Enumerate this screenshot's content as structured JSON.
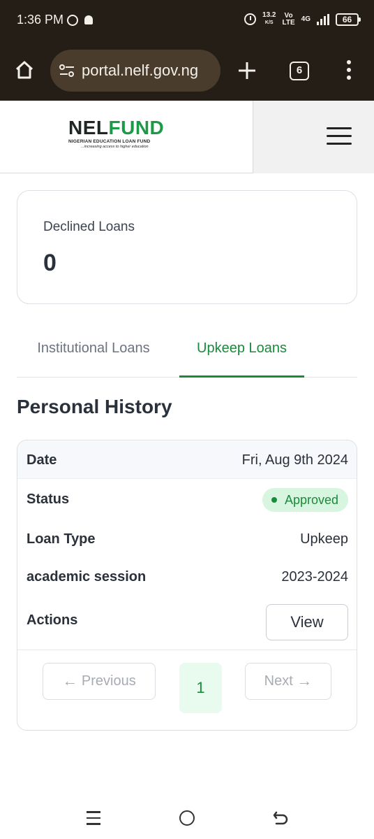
{
  "status_bar": {
    "time": "1:36 PM",
    "net_speed_value": "13.2",
    "net_speed_unit": "K/S",
    "volte_top": "Vo",
    "volte_bottom": "LTE",
    "network": "4G",
    "battery": "66",
    "icons": [
      "whatsapp-icon",
      "android-icon",
      "alarm-icon",
      "signal-icon",
      "battery-icon"
    ]
  },
  "browser": {
    "url": "portal.nelf.gov.ng",
    "tab_count": "6",
    "icons": [
      "home-icon",
      "tune-icon",
      "plus-icon",
      "tabs-icon",
      "menu-dots-icon"
    ]
  },
  "header": {
    "logo_part1": "NEL",
    "logo_part2": "FUND",
    "logo_subtitle": "NIGERIAN EDUCATION LOAN FUND",
    "logo_tagline": "...increasing access to higher education",
    "brand_color": "#1c9a48"
  },
  "declined": {
    "label": "Declined Loans",
    "value": "0"
  },
  "tabs": [
    {
      "label": "Institutional Loans",
      "active": false
    },
    {
      "label": "Upkeep Loans",
      "active": true
    }
  ],
  "section_title": "Personal History",
  "history": {
    "date_label": "Date",
    "date_value": "Fri, Aug 9th 2024",
    "status_label": "Status",
    "status_value": "Approved",
    "status_color": "#1a8a3b",
    "loan_type_label": "Loan Type",
    "loan_type_value": "Upkeep",
    "session_label": "academic session",
    "session_value": "2023-2024",
    "actions_label": "Actions",
    "view_label": "View"
  },
  "pagination": {
    "previous_label": "Previous",
    "next_label": "Next",
    "current_page": "1"
  }
}
